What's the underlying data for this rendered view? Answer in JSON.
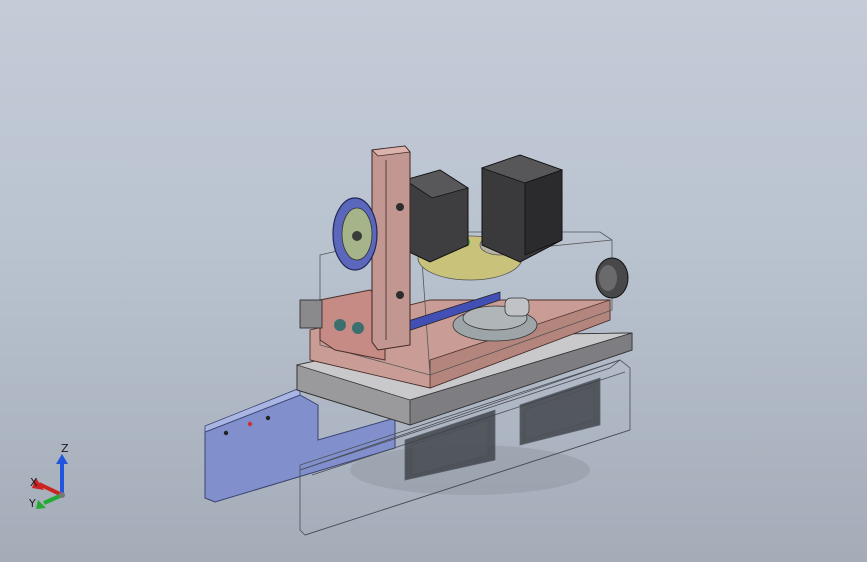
{
  "viewport": {
    "background_top": "#c4ccd8",
    "background_bottom": "#a4acb8"
  },
  "model": {
    "frame_color": "#7f8fc9",
    "motor_color": "#3d3d3d",
    "wheel_color": "#5a67b8",
    "sled_color": "#c59b93",
    "plate_color": "#d9d9d9",
    "gear_color": "#c9c27a"
  },
  "triad": {
    "z_label": "Z",
    "x_label": "X",
    "y_label": "Y",
    "z_color": "#2255dd",
    "x_color": "#cc2222",
    "y_color": "#22aa33"
  }
}
